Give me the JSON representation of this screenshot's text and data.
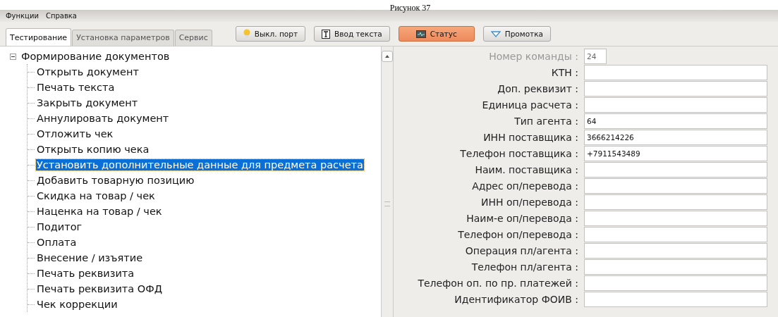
{
  "caption": "Рисунок 37",
  "menu": [
    "Функции",
    "Справка"
  ],
  "tabs": [
    {
      "label": "Тестирование",
      "selected": true
    },
    {
      "label": "Установка параметров",
      "selected": false
    },
    {
      "label": "Сервис",
      "selected": false
    }
  ],
  "toolbar": [
    {
      "label": "Выкл. порт",
      "kind": "bulb",
      "active": false
    },
    {
      "label": "Ввод текста",
      "kind": "text",
      "active": false
    },
    {
      "label": "Статус",
      "kind": "monitor",
      "active": true
    },
    {
      "label": "Промотка",
      "kind": "triangle",
      "active": false
    }
  ],
  "tree": [
    {
      "label": "Формирование документов",
      "expanded": true,
      "selected": false,
      "children": [
        {
          "label": "Открыть документ",
          "selected": false
        },
        {
          "label": "Печать текста",
          "selected": false
        },
        {
          "label": "Закрыть документ",
          "selected": false
        },
        {
          "label": "Аннулировать документ",
          "selected": false
        },
        {
          "label": "Отложить чек",
          "selected": false
        },
        {
          "label": "Открыть копию чека",
          "selected": false
        },
        {
          "label": "Установить дополнительные данные для предмета расчета",
          "selected": true
        },
        {
          "label": "Добавить товарную позицию",
          "selected": false
        },
        {
          "label": "Скидка на товар / чек",
          "selected": false
        },
        {
          "label": "Наценка на товар / чек",
          "selected": false
        },
        {
          "label": "Подитог",
          "selected": false
        },
        {
          "label": "Оплата",
          "selected": false
        },
        {
          "label": "Внесение / изъятие",
          "selected": false
        },
        {
          "label": "Печать реквизита",
          "selected": false
        },
        {
          "label": "Печать реквизита ОФД",
          "selected": false
        },
        {
          "label": "Чек коррекции",
          "selected": false
        }
      ]
    }
  ],
  "form": [
    {
      "label": "Номер команды :",
      "value": "24",
      "disabled": true
    },
    {
      "label": "КТН :",
      "disabled": false
    },
    {
      "label": "Доп. реквизит :",
      "disabled": false
    },
    {
      "label": "Единица расчета :",
      "disabled": false
    },
    {
      "label": "Тип агента :",
      "value": "64",
      "disabled": false
    },
    {
      "label": "ИНН поставщика :",
      "value": "3666214226",
      "disabled": false
    },
    {
      "label": "Телефон поставщика :",
      "value": "+7911543489",
      "disabled": false
    },
    {
      "label": "Наим. поставщика :",
      "disabled": false
    },
    {
      "label": "Адрес оп/перевода :",
      "disabled": false
    },
    {
      "label": "ИНН оп/перевода :",
      "disabled": false
    },
    {
      "label": "Наим-е оп/перевода :",
      "disabled": false
    },
    {
      "label": "Телефон оп/перевода :",
      "disabled": false
    },
    {
      "label": "Операция пл/агента :",
      "disabled": false
    },
    {
      "label": "Телефон пл/агента :",
      "disabled": false
    },
    {
      "label": "Телефон оп. по пр. платежей :",
      "disabled": false
    },
    {
      "label": "Идентификатор ФОИВ :",
      "disabled": false
    }
  ]
}
